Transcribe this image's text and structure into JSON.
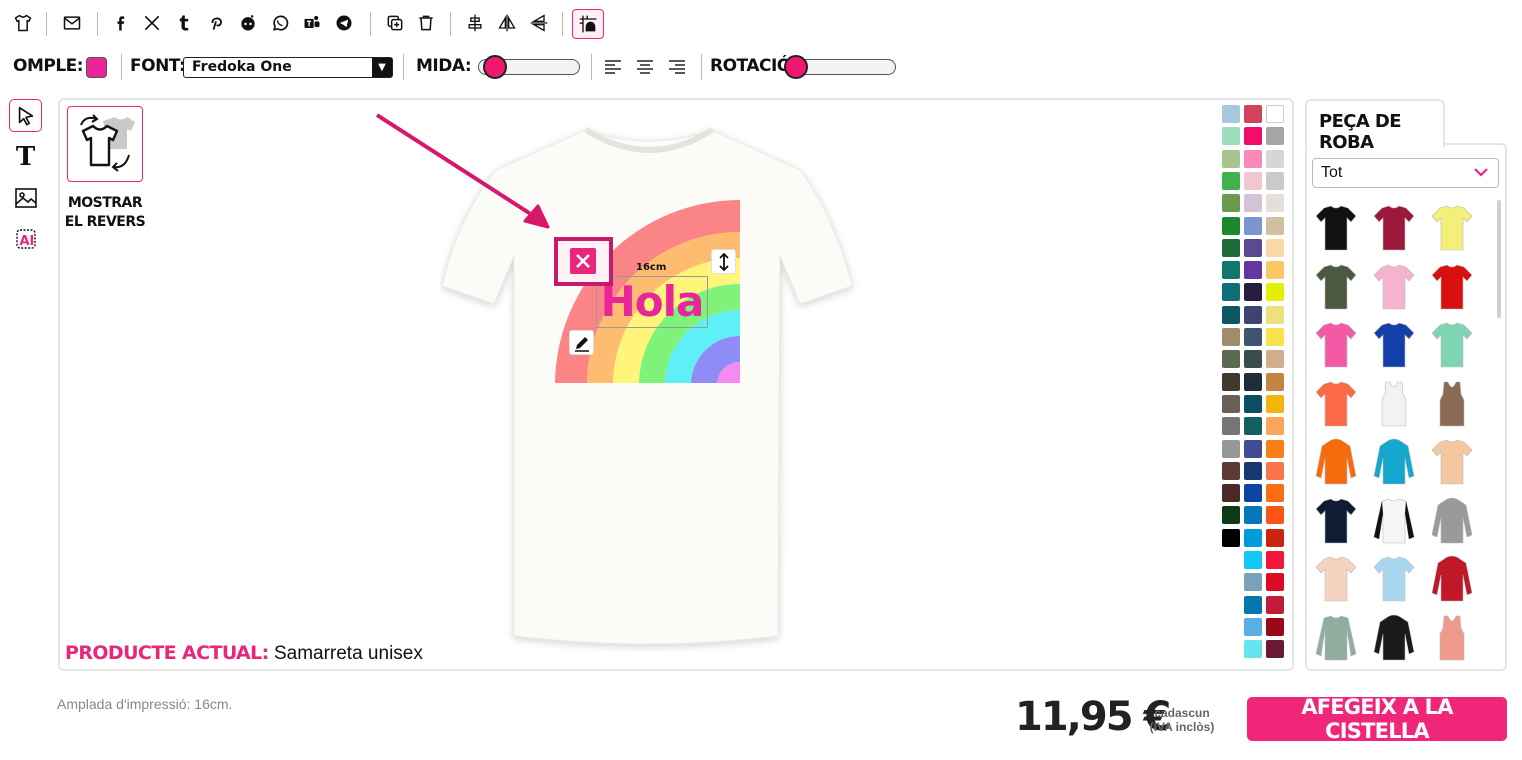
{
  "toolbar2": {
    "fill_label": "OMPLE:",
    "fill_color": "#e8259a",
    "font_label": "FONT:",
    "font_value": "Fredoka One",
    "size_label": "MIDA:",
    "rotation_label": "ROTACIÓ:"
  },
  "canvas": {
    "flip_label_1": "MOSTRAR",
    "flip_label_2": "EL REVERS",
    "width_indicator": "16cm",
    "design_text": "Hola",
    "design_text_color": "#e8259a",
    "current_product_label": "PRODUCTE ACTUAL:",
    "current_product_value": "Samarreta unisex"
  },
  "palette_colors": [
    [
      "#a9c7dd",
      "#d2435b",
      "#ffffff"
    ],
    [
      "#9fdcc0",
      "#f00d6b",
      "#a5a5a5"
    ],
    [
      "#a8c48c",
      "#fb88b9",
      "#d6d6d6"
    ],
    [
      "#3fb24e",
      "#f1c7cf",
      "#cacaca"
    ],
    [
      "#6a9a4f",
      "#d4c2d8",
      "#e4dfd7"
    ],
    [
      "#1a8a2f",
      "#7d95cf",
      "#d2bea0"
    ],
    [
      "#1d6b3a",
      "#5a4a90",
      "#f8d8a7"
    ],
    [
      "#11776a",
      "#6437a0",
      "#fbc765"
    ],
    [
      "#0f6f78",
      "#261d40",
      "#e5ee06"
    ],
    [
      "#0d5562",
      "#3e4470",
      "#ece07f"
    ],
    [
      "#a08d6c",
      "#3d5570",
      "#f6e34b"
    ],
    [
      "#5a6b52",
      "#3a4d4e",
      "#d1ae8b"
    ],
    [
      "#3f3a2c",
      "#1f2d3b",
      "#c28545"
    ],
    [
      "#6b5e56",
      "#0c4f63",
      "#f3b40b"
    ],
    [
      "#767676",
      "#116161",
      "#f9a55a"
    ],
    [
      "#979797",
      "#404c93",
      "#f97e15"
    ],
    [
      "#5b3a38",
      "#17386e",
      "#f8754c"
    ],
    [
      "#4a2a26",
      "#0c45a2",
      "#f96d14"
    ],
    [
      "#0d3b15",
      "#0877b8",
      "#fb5418"
    ],
    [
      "#000000",
      "#009bd9",
      "#cb250d"
    ],
    [
      "",
      "#13c8f3",
      "#f4153a"
    ],
    [
      "",
      "#78a3b9",
      "#dc0b21"
    ],
    [
      "",
      "#0478ac",
      "#c21a39"
    ],
    [
      "",
      "#5aaee6",
      "#9a0919"
    ],
    [
      "",
      "#67e2ef",
      "#6a1a32"
    ]
  ],
  "panel": {
    "tab_label": "PEÇA DE ROBA",
    "filter_value": "Tot",
    "garments": [
      {
        "name": "tshirt-black",
        "color": "#111111",
        "kind": "tee"
      },
      {
        "name": "tshirt-burgundy",
        "color": "#9b1a3c",
        "kind": "tee"
      },
      {
        "name": "tshirt-yellow",
        "color": "#f3ef7a",
        "kind": "tee"
      },
      {
        "name": "tshirt-olive",
        "color": "#4d5840",
        "kind": "tee"
      },
      {
        "name": "tshirt-light-pink",
        "color": "#f6b3cf",
        "kind": "tee"
      },
      {
        "name": "tshirt-red",
        "color": "#d81010",
        "kind": "tee"
      },
      {
        "name": "tshirt-pink-women",
        "color": "#f25aa6",
        "kind": "tee"
      },
      {
        "name": "tshirt-royal-blue",
        "color": "#1240a8",
        "kind": "tee"
      },
      {
        "name": "tshirt-mint",
        "color": "#7fd4b4",
        "kind": "tee"
      },
      {
        "name": "tshirt-coral",
        "color": "#fb6a44",
        "kind": "tee"
      },
      {
        "name": "tanktop-white",
        "color": "#f2f2f2",
        "kind": "tank"
      },
      {
        "name": "tanktop-brown",
        "color": "#8a6a55",
        "kind": "tank"
      },
      {
        "name": "hoodie-orange",
        "color": "#f66b0d",
        "kind": "hoodie"
      },
      {
        "name": "hoodie-turquoise",
        "color": "#14a8cf",
        "kind": "hoodie"
      },
      {
        "name": "tshirt-tie-dye",
        "color": "#f3c7a0",
        "kind": "tee"
      },
      {
        "name": "tshirt-navy",
        "color": "#101b34",
        "kind": "tee"
      },
      {
        "name": "raglan-white-black",
        "color": "#f5f5f5",
        "kind": "raglan"
      },
      {
        "name": "hoodie-grey",
        "color": "#9a9a9a",
        "kind": "hoodie"
      },
      {
        "name": "tshirt-peach",
        "color": "#f4d4c0",
        "kind": "tee"
      },
      {
        "name": "tshirt-gradient-blue",
        "color": "#a9d8ee",
        "kind": "tee"
      },
      {
        "name": "jacket-varsity-red",
        "color": "#c01828",
        "kind": "hoodie"
      },
      {
        "name": "longsleeve-sage",
        "color": "#8fae9e",
        "kind": "long"
      },
      {
        "name": "hoodie-black-orange",
        "color": "#1a1a1a",
        "kind": "hoodie"
      },
      {
        "name": "tanktop-salmon",
        "color": "#ee9a8c",
        "kind": "tank"
      }
    ]
  },
  "footer": {
    "print_width": "Amplada d'impressió: 16cm.",
    "price": "11,95 €",
    "price_note_1": "cadascun",
    "price_note_2": "(IVA inclòs)",
    "add_to_cart": "AFEGEIX A LA CISTELLA"
  },
  "icons": {
    "top_toolbar": [
      "tshirt-icon",
      "email-icon",
      "facebook-icon",
      "x-twitter-icon",
      "tumblr-icon",
      "pinterest-icon",
      "reddit-icon",
      "whatsapp-icon",
      "teams-icon",
      "telegram-icon",
      "duplicate-icon",
      "trash-icon",
      "align-center-icon",
      "flip-horizontal-icon",
      "flip-vertical-icon",
      "grid-snap-icon"
    ],
    "left_tools": [
      "select-cursor-icon",
      "text-tool-icon",
      "image-tool-icon",
      "ai-tool-icon"
    ]
  }
}
